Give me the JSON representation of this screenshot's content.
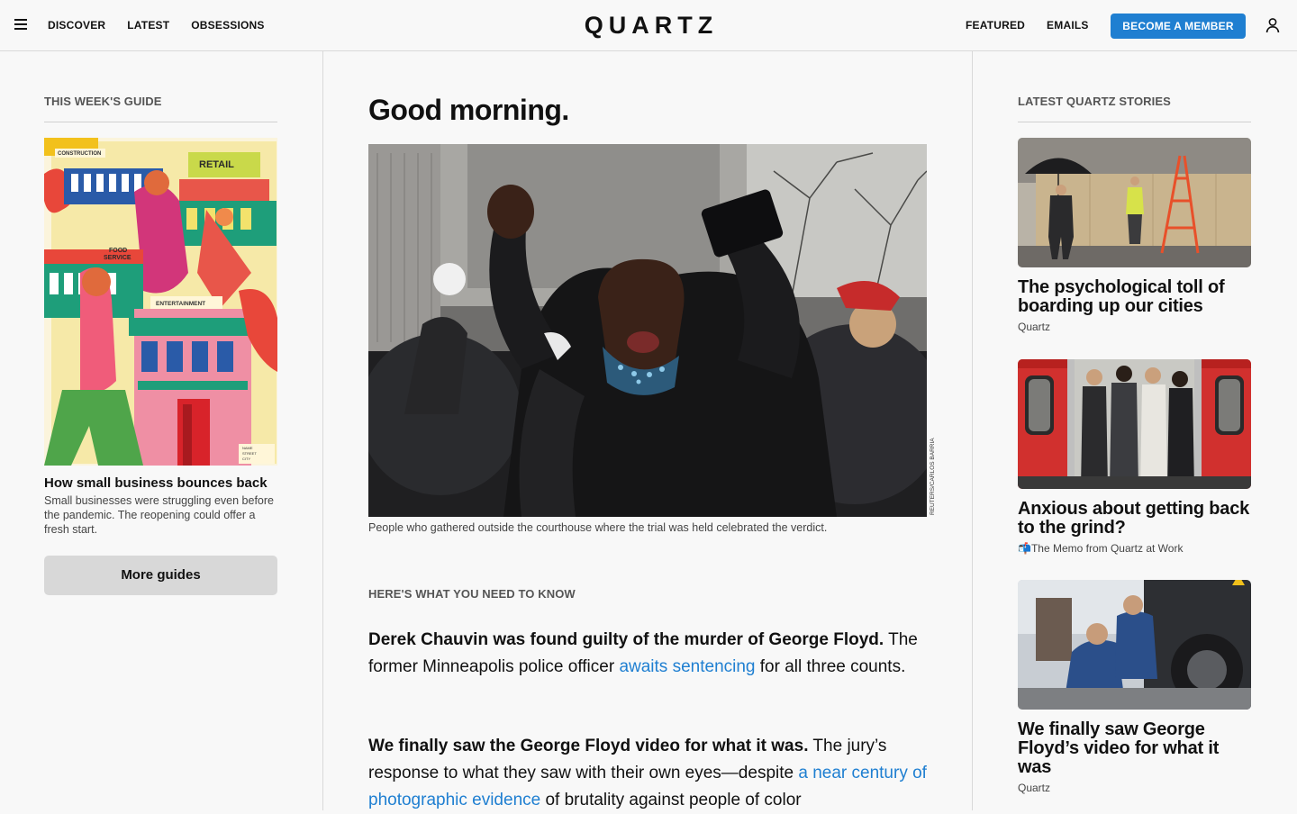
{
  "header": {
    "nav_left": [
      "DISCOVER",
      "LATEST",
      "OBSESSIONS"
    ],
    "logo": "QUARTZ",
    "nav_right": [
      "FEATURED",
      "EMAILS"
    ],
    "member_button": "BECOME A MEMBER",
    "accent_color": "#1f7fd1"
  },
  "left": {
    "section_label": "THIS WEEK'S GUIDE",
    "guide": {
      "title": "How small business bounces back",
      "description": "Small businesses were struggling even before the pandemic. The reopening could offer a fresh start.",
      "illustration_labels": {
        "construction": "CONSTRUCTION",
        "retail": "RETAIL",
        "food_line1": "FOOD",
        "food_line2": "SERVICE",
        "entertainment": "ENTERTAINMENT",
        "form_name": "NAME",
        "form_street": "STREET",
        "form_city": "CITY"
      }
    },
    "more_button": "More guides"
  },
  "center": {
    "greeting": "Good morning.",
    "hero_credit": "REUTERS/CARLOS BARRIA",
    "hero_caption": "People who gathered outside the courthouse where the trial was held celebrated the verdict.",
    "section_label": "HERE'S WHAT YOU NEED TO KNOW",
    "briefs": [
      {
        "headline": "Derek Chauvin was found guilty of the murder of George Floyd.",
        "text_before": " The former Minneapolis police officer ",
        "link": "awaits sentencing",
        "text_after": " for all three counts."
      },
      {
        "headline": "We finally saw the George Floyd video for what it was.",
        "text_before": " The jury’s response to what they saw with their own eyes—despite ",
        "link": "a near century of photographic evidence",
        "text_after": " of brutality against people of color"
      }
    ]
  },
  "right": {
    "section_label": "LATEST QUARTZ STORIES",
    "stories": [
      {
        "title": "The psychological toll of boarding up our cities",
        "source": "Quartz",
        "source_icon": ""
      },
      {
        "title": "Anxious about getting back to the grind?",
        "source": "The Memo from Quartz at Work",
        "source_icon": "📬"
      },
      {
        "title": "We finally saw George Floyd’s video for what it was",
        "source": "Quartz",
        "source_icon": ""
      }
    ]
  },
  "icons": {
    "menu": "hamburger-menu-icon",
    "account": "user-account-icon"
  }
}
